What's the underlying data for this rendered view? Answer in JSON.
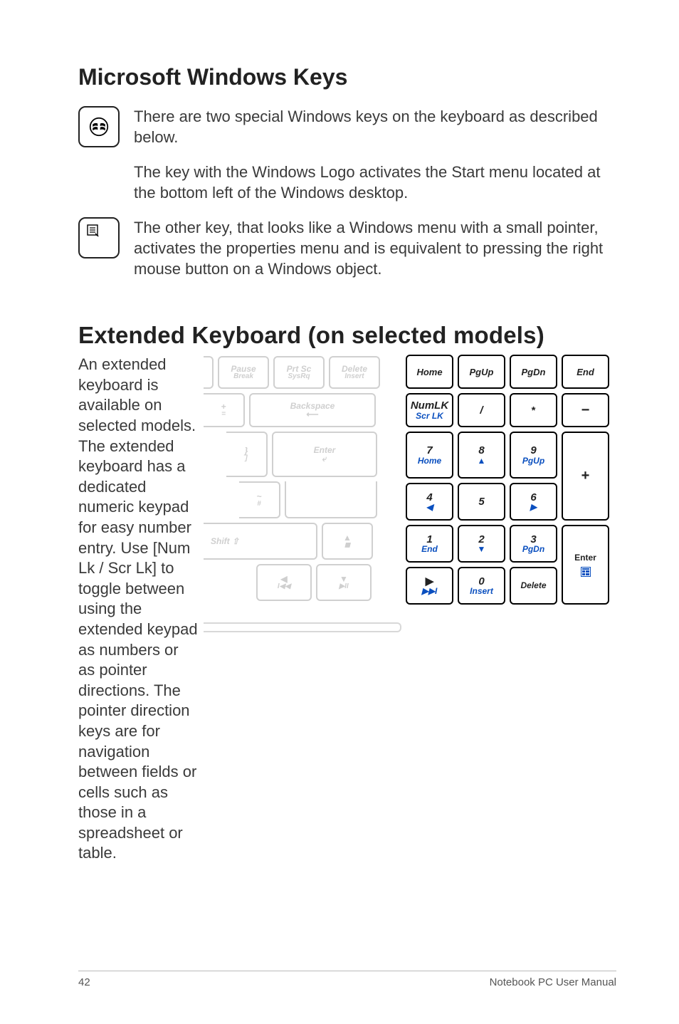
{
  "section1": {
    "heading": "Microsoft Windows Keys",
    "para1": "There are two special Windows keys on the keyboard as described below.",
    "para2": "The key with the Windows Logo activates the Start menu located at the bottom left of the Windows desktop.",
    "para3": "The other key, that looks like a Windows menu with a small pointer, activates the properties menu and is equivalent to pressing the right mouse button on a Windows object."
  },
  "section2": {
    "heading": "Extended Keyboard (on selected models)",
    "body": "An extended keyboard is available on selected models. The extended keyboard has a dedicated numeric keypad for easy number entry. Use [Num Lk / Scr Lk] to toggle between using the extended keypad as numbers or as pointer directions. The pointer direction keys are for navigation between fields or cells such as those in a spreadsheet or table."
  },
  "ghost": {
    "pause": "Pause",
    "break": "Break",
    "prtsc": "Prt Sc",
    "sysrq": "SysRq",
    "delete": "Delete",
    "insert": "Insert",
    "backspace": "Backspace",
    "plus": "+",
    "equals": "=",
    "rbracket": "}",
    "rbracket2": "]",
    "enter": "Enter",
    "tilde": "~",
    "hash": "#",
    "shift": "Shift  ⇧",
    "stop": "◼",
    "prev": "◀",
    "prev2": "I◀◀",
    "play": "▶II",
    "up": "▲",
    "down": "▼"
  },
  "num": {
    "home": "Home",
    "pgup": "PgUp",
    "pgdn": "PgDn",
    "end": "End",
    "numlk": "NumLK",
    "scrlk": "Scr LK",
    "slash": "/",
    "star": "*",
    "minus": "−",
    "plus": "+",
    "k7": "7",
    "k7a": "Home",
    "k8": "8",
    "k8a": "▲",
    "k9": "9",
    "k9a": "PgUp",
    "k4": "4",
    "k4a": "◀",
    "k5": "5",
    "k6": "6",
    "k6a": "▶",
    "k1": "1",
    "k1a": "End",
    "k2": "2",
    "k2a": "▼",
    "k3": "3",
    "k3a": "PgDn",
    "enter": "Enter",
    "kplay": "▶",
    "kplay2": "▶▶I",
    "k0": "0",
    "k0a": "Insert",
    "kdel": "Delete"
  },
  "footer": {
    "page": "42",
    "title": "Notebook PC User Manual"
  }
}
